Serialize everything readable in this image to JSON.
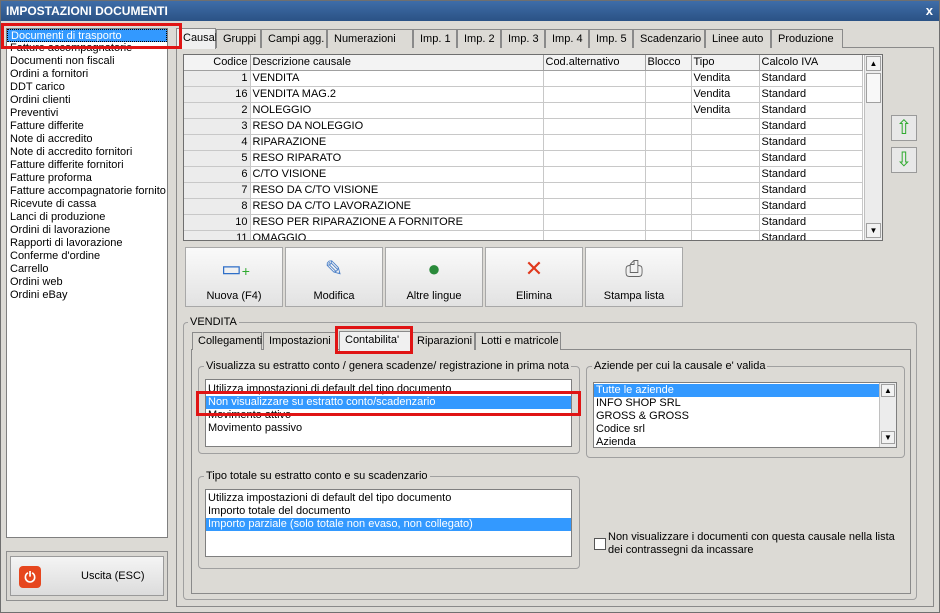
{
  "window": {
    "title": "IMPOSTAZIONI DOCUMENTI",
    "close": "x"
  },
  "left_list": {
    "items": [
      "Documenti di trasporto",
      "Fatture accompagnatorie",
      "Documenti non fiscali",
      "Ordini a fornitori",
      "DDT carico",
      "Ordini clienti",
      "Preventivi",
      "Fatture differite",
      "Note di accredito",
      "Note di accredito fornitori",
      "Fatture differite fornitori",
      "Fatture proforma",
      "Fatture accompagnatorie fornito",
      "Ricevute di cassa",
      "Lanci di produzione",
      "Ordini di lavorazione",
      "Rapporti di lavorazione",
      "Conferme d'ordine",
      "Carrello",
      "Ordini web",
      "Ordini eBay"
    ],
    "selected": 0
  },
  "exit_button": "Uscita (ESC)",
  "tabs": [
    "Causali",
    "Gruppi",
    "Campi agg.",
    "Numerazioni",
    "Imp. 1",
    "Imp. 2",
    "Imp. 3",
    "Imp. 4",
    "Imp. 5",
    "Scadenzario",
    "Linee auto",
    "Produzione"
  ],
  "grid": {
    "headers": [
      "Codice",
      "Descrizione causale",
      "Cod.alternativo",
      "Blocco",
      "Tipo",
      "Calcolo IVA"
    ],
    "rows": [
      [
        "1",
        "VENDITA",
        "",
        "",
        "Vendita",
        "Standard"
      ],
      [
        "16",
        "VENDITA MAG.2",
        "",
        "",
        "Vendita",
        "Standard"
      ],
      [
        "2",
        "NOLEGGIO",
        "",
        "",
        "Vendita",
        "Standard"
      ],
      [
        "3",
        "RESO DA NOLEGGIO",
        "",
        "",
        "",
        "Standard"
      ],
      [
        "4",
        "RIPARAZIONE",
        "",
        "",
        "",
        "Standard"
      ],
      [
        "5",
        "RESO RIPARATO",
        "",
        "",
        "",
        "Standard"
      ],
      [
        "6",
        "C/TO VISIONE",
        "",
        "",
        "",
        "Standard"
      ],
      [
        "7",
        "RESO DA C/TO VISIONE",
        "",
        "",
        "",
        "Standard"
      ],
      [
        "8",
        "RESO DA C/TO LAVORAZIONE",
        "",
        "",
        "",
        "Standard"
      ],
      [
        "10",
        "RESO PER RIPARAZIONE A FORNITORE",
        "",
        "",
        "",
        "Standard"
      ],
      [
        "11",
        "OMAGGIO",
        "",
        "",
        "",
        "Standard"
      ]
    ]
  },
  "toolbar": {
    "new": "Nuova (F4)",
    "edit": "Modifica",
    "languages": "Altre lingue",
    "delete": "Elimina",
    "print": "Stampa lista"
  },
  "vendita_label": "VENDITA",
  "subtabs": [
    "Collegamenti",
    "Impostazioni",
    "Contabilita'",
    "Riparazioni",
    "Lotti e matricole"
  ],
  "estratto": {
    "title": "Visualizza su estratto conto / genera scadenze/ registrazione  in prima nota",
    "options": [
      "Utilizza impostazioni di default del tipo documento",
      "Non visualizzare su estratto conto/scadenzario",
      "Movimento attivo",
      "Movimento passivo"
    ],
    "selected": 1
  },
  "aziende": {
    "title": "Aziende per cui la causale e' valida",
    "options": [
      "Tutte le aziende",
      "INFO SHOP SRL",
      "GROSS & GROSS",
      "Codice srl",
      "Azienda"
    ],
    "selected": 0
  },
  "tipo_totale": {
    "title": "Tipo totale su estratto conto e su scadenzario",
    "options": [
      "Utilizza impostazioni di default del tipo documento",
      "Importo totale del documento",
      "Importo parziale (solo totale non evaso, non collegato)"
    ],
    "selected": 2
  },
  "checkbox_label": "Non visualizzare i documenti con questa causale nella lista dei contrassegni da incassare",
  "colors": {
    "selection": "#3399ff",
    "highlight": "#e01414",
    "title_bar": "#2f5a94"
  }
}
